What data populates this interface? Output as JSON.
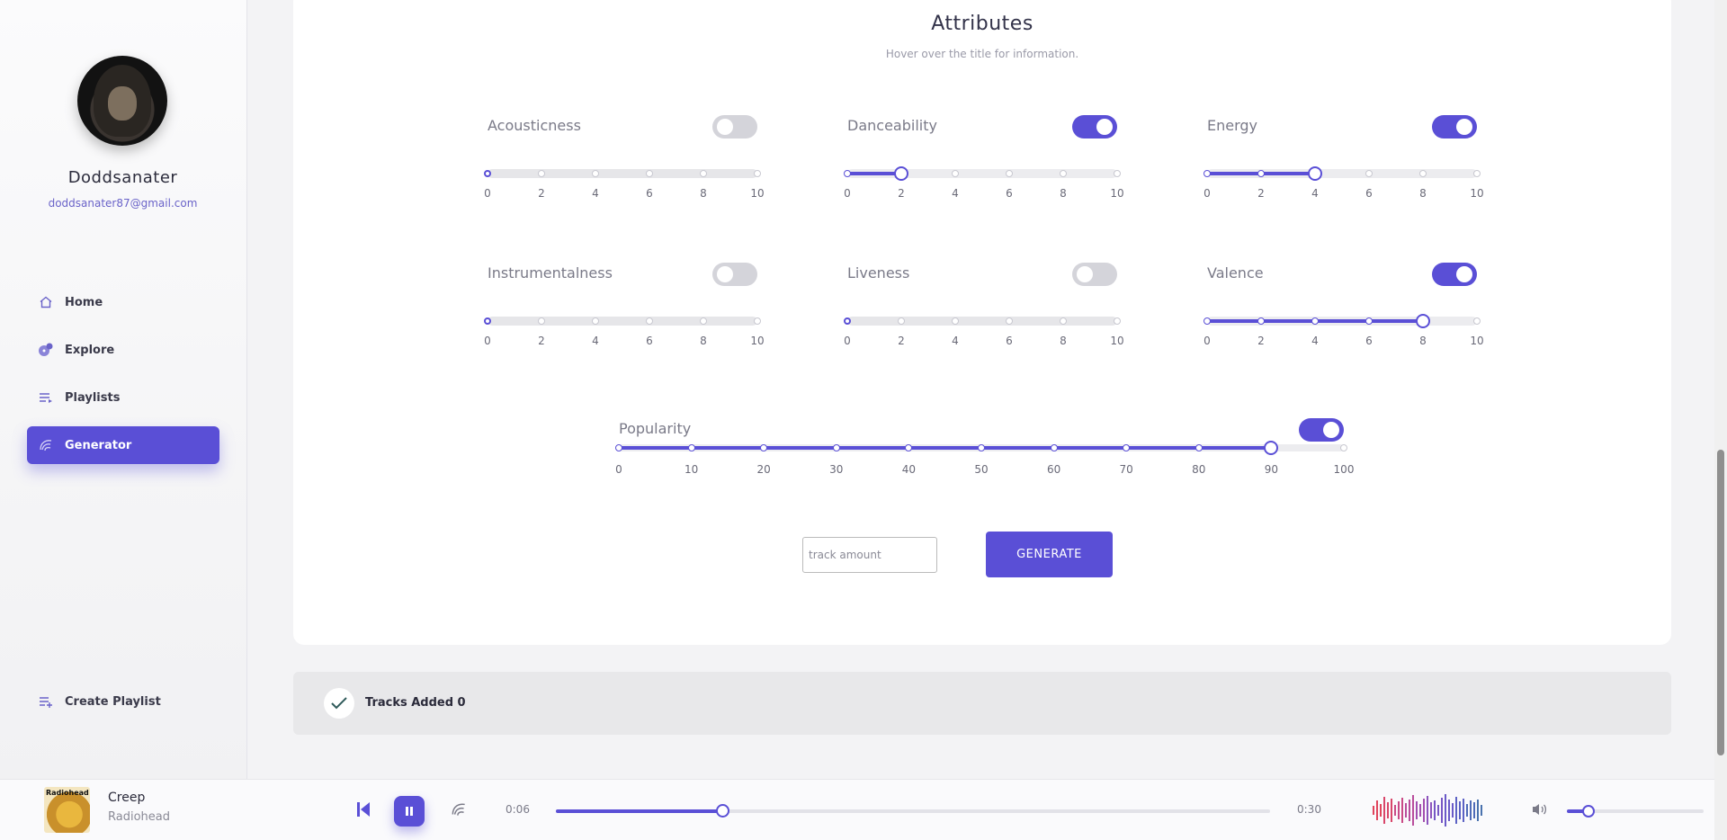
{
  "sidebar": {
    "username": "Doddsanater",
    "email": "doddsanater87@gmail.com",
    "nav": [
      {
        "label": "Home",
        "icon": "home-icon"
      },
      {
        "label": "Explore",
        "icon": "explore-icon"
      },
      {
        "label": "Playlists",
        "icon": "playlist-icon"
      },
      {
        "label": "Generator",
        "icon": "generator-icon",
        "active": true
      }
    ],
    "create_playlist": "Create Playlist"
  },
  "main": {
    "title": "Attributes",
    "subtitle": "Hover over the title for information.",
    "attributes": [
      {
        "label": "Acousticness",
        "enabled": false,
        "value": 0,
        "ticks": [
          "0",
          "2",
          "4",
          "6",
          "8",
          "10"
        ]
      },
      {
        "label": "Danceability",
        "enabled": true,
        "value": 2,
        "ticks": [
          "0",
          "2",
          "4",
          "6",
          "8",
          "10"
        ]
      },
      {
        "label": "Energy",
        "enabled": true,
        "value": 4,
        "ticks": [
          "0",
          "2",
          "4",
          "6",
          "8",
          "10"
        ]
      },
      {
        "label": "Instrumentalness",
        "enabled": false,
        "value": 0,
        "ticks": [
          "0",
          "2",
          "4",
          "6",
          "8",
          "10"
        ]
      },
      {
        "label": "Liveness",
        "enabled": false,
        "value": 0,
        "ticks": [
          "0",
          "2",
          "4",
          "6",
          "8",
          "10"
        ]
      },
      {
        "label": "Valence",
        "enabled": true,
        "value": 8,
        "ticks": [
          "0",
          "2",
          "4",
          "6",
          "8",
          "10"
        ]
      }
    ],
    "popularity": {
      "label": "Popularity",
      "enabled": true,
      "value": 90,
      "ticks": [
        "0",
        "10",
        "20",
        "30",
        "40",
        "50",
        "60",
        "70",
        "80",
        "90",
        "100"
      ]
    },
    "track_amount_placeholder": "track amount",
    "generate_label": "GENERATE"
  },
  "status": {
    "tracks_added": "Tracks Added 0"
  },
  "player": {
    "album_text": "Radiohead",
    "song": "Creep",
    "artist": "Radiohead",
    "elapsed": "0:06",
    "duration": "0:30",
    "progress_fraction": 0.2333,
    "volume_fraction": 0.16
  },
  "colors": {
    "accent": "#5a4fd6",
    "toggle_off": "#d4d4da"
  }
}
